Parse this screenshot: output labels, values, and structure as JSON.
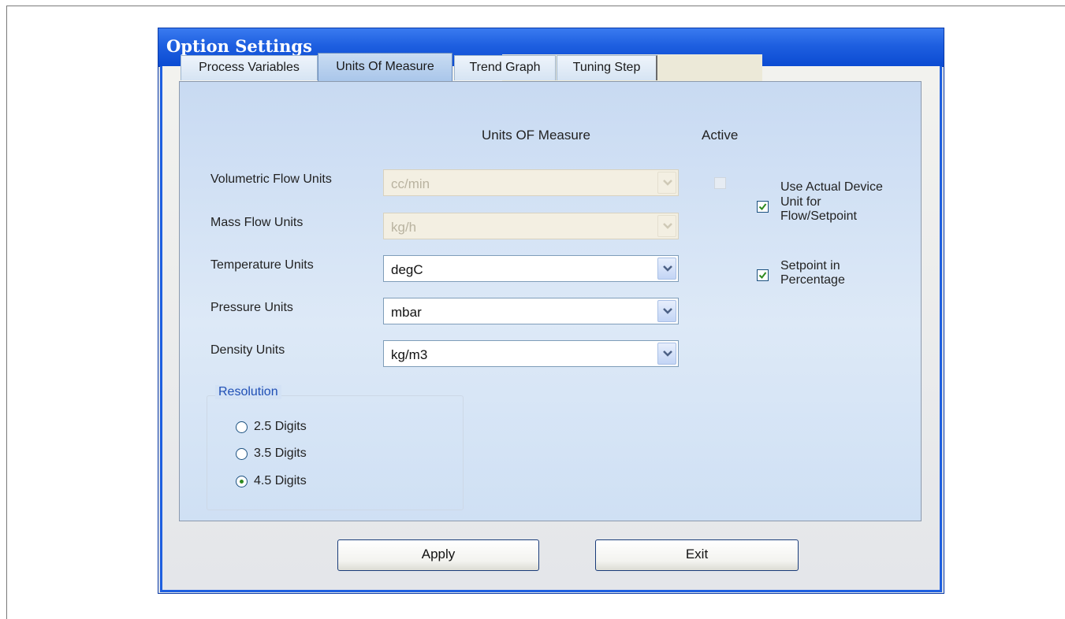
{
  "window": {
    "title": "Option Settings"
  },
  "tabs": [
    {
      "label": "Process Variables",
      "active": false
    },
    {
      "label": "Units Of Measure",
      "active": true
    },
    {
      "label": "Trend Graph",
      "active": false
    },
    {
      "label": "Tuning Step",
      "active": false
    }
  ],
  "units_panel": {
    "header_units": "Units OF Measure",
    "header_active": "Active",
    "rows": [
      {
        "label": "Volumetric Flow Units",
        "value": "cc/min",
        "enabled": false
      },
      {
        "label": "Mass Flow Units",
        "value": "kg/h",
        "enabled": false
      },
      {
        "label": "Temperature Units",
        "value": "degC",
        "enabled": true
      },
      {
        "label": "Pressure Units",
        "value": "mbar",
        "enabled": true
      },
      {
        "label": "Density Units",
        "value": "kg/m3",
        "enabled": true
      }
    ],
    "options": {
      "use_actual_device_unit": {
        "label_line1": "Use Actual Device",
        "label_line2": "Unit for",
        "label_line3": "Flow/Setpoint",
        "checked": true
      },
      "setpoint_in_percentage": {
        "label_line1": "Setpoint in",
        "label_line2": "Percentage",
        "checked": true
      }
    }
  },
  "resolution": {
    "title": "Resolution",
    "options": [
      {
        "label": "2.5 Digits",
        "selected": false
      },
      {
        "label": "3.5 Digits",
        "selected": false
      },
      {
        "label": "4.5 Digits",
        "selected": true
      }
    ]
  },
  "buttons": {
    "apply": "Apply",
    "exit": "Exit"
  },
  "colors": {
    "titlebar": "#1e5fe0",
    "panel": "#cfe0f4",
    "group_title": "#1f4fb5",
    "check": "#2f8a1f"
  }
}
